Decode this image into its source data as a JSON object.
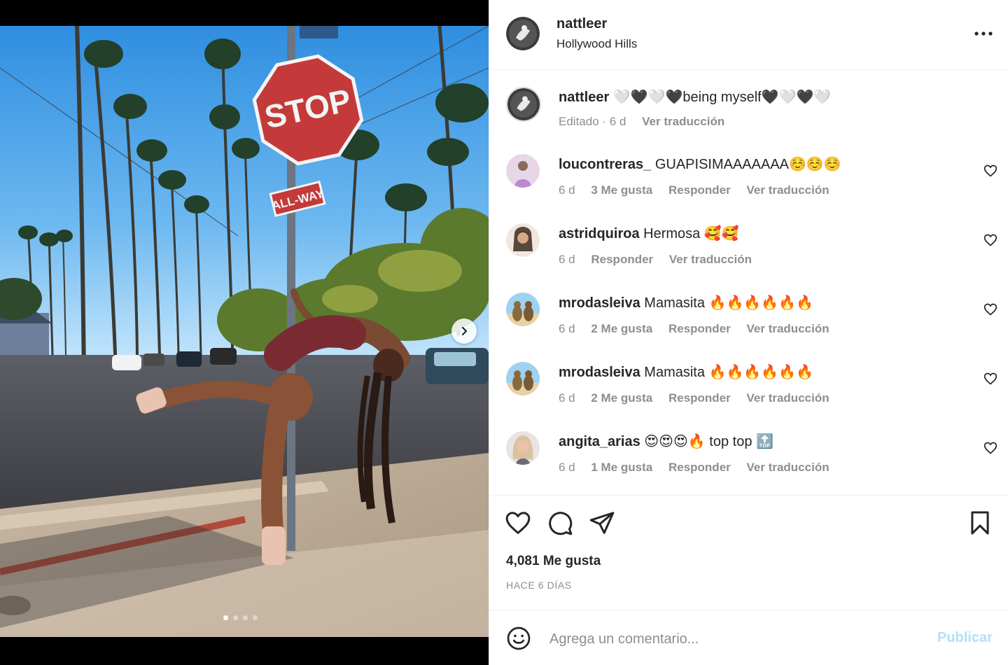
{
  "colors": {
    "accent": "#0095f6",
    "accent_disabled": "#b2dffc",
    "text_primary": "#262626",
    "text_secondary": "#8e8e8e",
    "divider": "#efefef"
  },
  "media": {
    "next_icon": "chevron-right-icon",
    "carousel": {
      "count": 4,
      "active_index": 0
    },
    "sign_text": "STOP",
    "sub_sign_text": "ALL-WAY"
  },
  "header": {
    "username": "nattleer",
    "location": "Hollywood Hills",
    "more_icon": "more-horizontal-icon"
  },
  "caption": {
    "username": "nattleer",
    "text": "🤍🖤🤍🖤being myself🖤🤍🖤🤍",
    "edited_label": "Editado",
    "separator": " · ",
    "time": "6 d",
    "translate_label": "Ver traducción"
  },
  "comments": [
    {
      "username": "loucontreras_",
      "text": "GUAPISIMAAAAAAA☺️☺️☺️",
      "time": "6 d",
      "likes": "3 Me gusta",
      "reply": "Responder",
      "translate": "Ver traducción"
    },
    {
      "username": "astridquiroa",
      "text": "Hermosa 🥰🥰",
      "time": "6 d",
      "likes": "",
      "reply": "Responder",
      "translate": "Ver traducción"
    },
    {
      "username": "mrodasleiva",
      "text": "Mamasita 🔥🔥🔥🔥🔥🔥",
      "time": "6 d",
      "likes": "2 Me gusta",
      "reply": "Responder",
      "translate": "Ver traducción"
    },
    {
      "username": "mrodasleiva",
      "text": "Mamasita 🔥🔥🔥🔥🔥🔥",
      "time": "6 d",
      "likes": "2 Me gusta",
      "reply": "Responder",
      "translate": "Ver traducción"
    },
    {
      "username": "angita_arias",
      "text": "😍😍😍🔥 top top 🔝",
      "time": "6 d",
      "likes": "1 Me gusta",
      "reply": "Responder",
      "translate": "Ver traducción"
    }
  ],
  "actions": {
    "like_icon": "heart-icon",
    "comment_icon": "comment-icon",
    "share_icon": "send-icon",
    "save_icon": "bookmark-icon",
    "likes_text": "4,081 Me gusta",
    "time_ago": "HACE 6 DÍAS"
  },
  "add_comment": {
    "emoji_icon": "smiley-icon",
    "placeholder": "Agrega un comentario...",
    "publish_label": "Publicar"
  }
}
